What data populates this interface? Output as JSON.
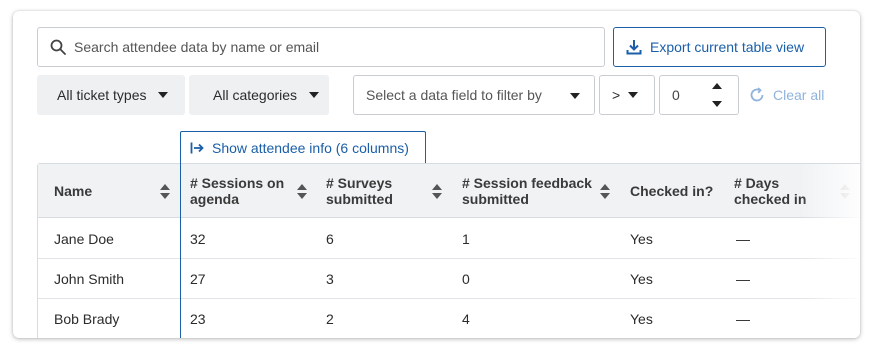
{
  "search": {
    "placeholder": "Search attendee data by name or email",
    "icon": "search-icon"
  },
  "export": {
    "label": "Export current table view",
    "icon": "download-icon"
  },
  "filters": {
    "ticket_types": "All ticket types",
    "categories": "All categories",
    "data_field_placeholder": "Select a data field to filter by",
    "operator": ">",
    "value": "0",
    "clear_all": "Clear all"
  },
  "show_info": {
    "label": "Show attendee info (6 columns)",
    "icon": "expand-right-icon"
  },
  "table": {
    "columns": [
      {
        "line1": "Name",
        "line2": ""
      },
      {
        "line1": "# Sessions on",
        "line2": "agenda"
      },
      {
        "line1": "# Surveys",
        "line2": "submitted"
      },
      {
        "line1": "# Session feedback",
        "line2": "submitted"
      },
      {
        "line1": "Checked in?",
        "line2": ""
      },
      {
        "line1": "# Days",
        "line2": "checked in"
      }
    ],
    "rows": [
      {
        "name": "Jane Doe",
        "sessions": "32",
        "surveys": "6",
        "feedback": "1",
        "checked_in": "Yes",
        "days": "—"
      },
      {
        "name": "John Smith",
        "sessions": "27",
        "surveys": "3",
        "feedback": "0",
        "checked_in": "Yes",
        "days": "—"
      },
      {
        "name": "Bob Brady",
        "sessions": "23",
        "surveys": "2",
        "feedback": "4",
        "checked_in": "Yes",
        "days": "—"
      }
    ]
  },
  "colors": {
    "accent": "#1a5fa8",
    "accent_disabled": "#8fb4dc",
    "header_bg": "#f0f2f4",
    "filter_bg": "#eef0f2"
  }
}
